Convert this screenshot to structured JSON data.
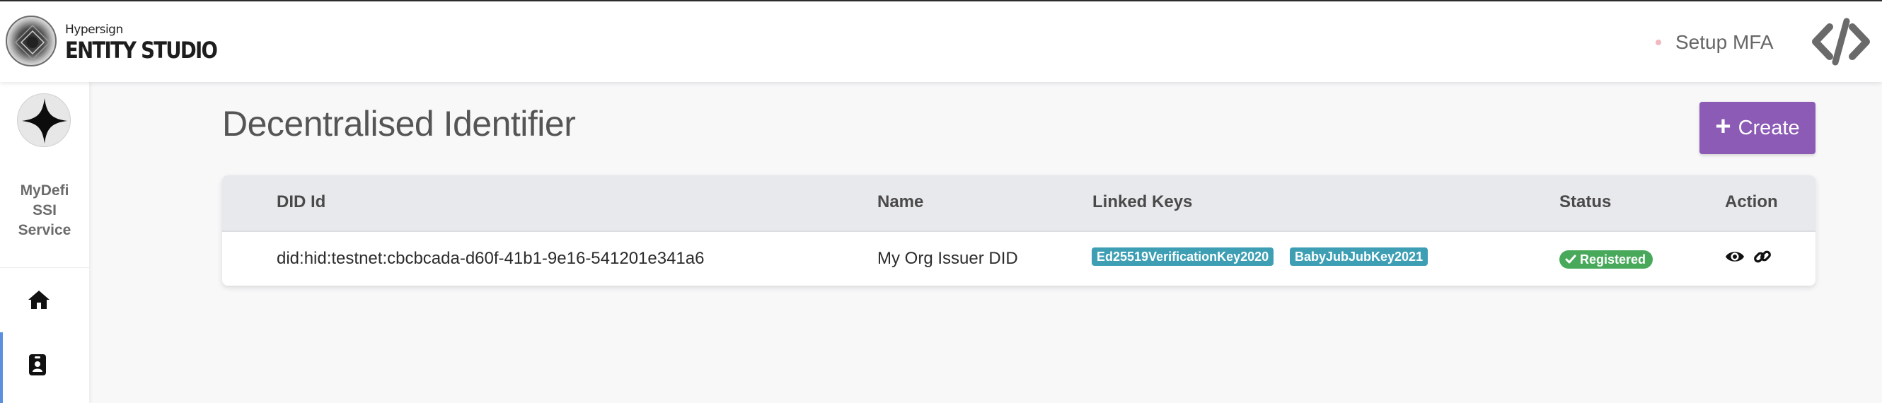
{
  "header": {
    "brand_small": "Hypersign",
    "brand_big": "ENTITY STUDIO",
    "mfa_label": "Setup MFA",
    "code_icon": "code-icon"
  },
  "sidebar": {
    "org_logo_icon": "four-point-star-icon",
    "org_name_lines": [
      "MyDefi",
      "SSI",
      "Service"
    ],
    "items": [
      {
        "icon": "home-icon",
        "active": false
      },
      {
        "icon": "id-badge-icon",
        "active": true
      }
    ],
    "active_color": "#5b8fe0"
  },
  "main": {
    "title": "Decentralised Identifier",
    "create_label": "Create",
    "create_color": "#8c5bb5",
    "table": {
      "columns": [
        "DID Id",
        "Name",
        "Linked Keys",
        "Status",
        "Action"
      ],
      "rows": [
        {
          "did_id": "did:hid:testnet:cbcbcada-d60f-41b1-9e16-541201e341a6",
          "name": "My Org Issuer DID",
          "linked_keys": [
            "Ed25519VerificationKey2020",
            "BabyJubJubKey2021"
          ],
          "status": "Registered",
          "actions": [
            "eye-icon",
            "link-icon"
          ]
        }
      ]
    },
    "key_badge_color": "#3e9fb4",
    "status_color": "#48a95b"
  }
}
